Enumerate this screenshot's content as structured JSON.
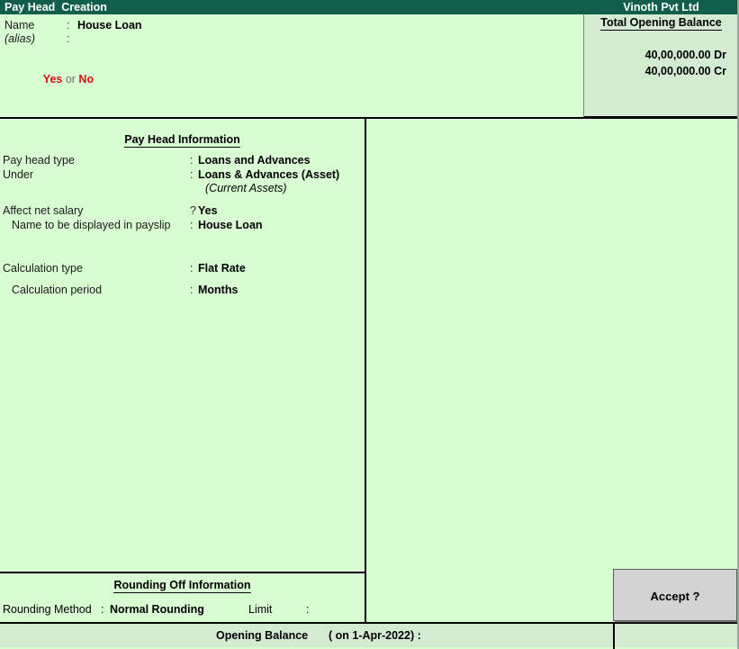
{
  "titlebar": {
    "app_title": "Pay Head  Creation",
    "company": "Vinoth Pvt Ltd",
    "bg_color": "#115e4c",
    "text_color": "#ffffff"
  },
  "name_area": {
    "name_label": "Name",
    "name_colon": ":",
    "name_value": "House Loan",
    "alias_label": "(alias)",
    "alias_colon": ":",
    "alias_value": ""
  },
  "total_opening_balance": {
    "title": "Total Opening Balance",
    "debit": "40,00,000.00 Dr",
    "credit": "40,00,000.00 Cr"
  },
  "pay_head_information": {
    "title": "Pay Head Information",
    "rows": [
      {
        "label": "Pay head type",
        "sep": ":",
        "value": "Loans and Advances"
      },
      {
        "label": "Under",
        "sep": ":",
        "value": "Loans & Advances (Asset)",
        "sub": "(Current Assets)"
      },
      {
        "label": "Affect net salary",
        "sep": "?",
        "value": "Yes"
      },
      {
        "label": "Name to be displayed in payslip",
        "sep": ":",
        "value": "House Loan"
      },
      {
        "label": "Calculation type",
        "sep": ":",
        "value": "Flat Rate"
      },
      {
        "label": "Calculation period",
        "sep": ":",
        "value": "Months"
      }
    ]
  },
  "rounding_off_information": {
    "title": "Rounding Off Information",
    "method_label": "Rounding Method",
    "method_sep": ":",
    "method_value": "Normal Rounding",
    "limit_label": "Limit",
    "limit_sep": ":",
    "limit_value": ""
  },
  "accept_box": {
    "question": "Accept ?",
    "yes": "Yes",
    "or": " or ",
    "no": "No",
    "yes_no_color": "#d41414"
  },
  "statusbar": {
    "opening_balance_label": "Opening Balance",
    "opening_balance_date": "( on 1-Apr-2022) :",
    "opening_balance_value": ""
  },
  "colors": {
    "window_bg": "#d9fdd3",
    "panel_bg": "#d3ecd1",
    "header_green": "#115e4c",
    "accept_bg": "#d3d3d3"
  }
}
